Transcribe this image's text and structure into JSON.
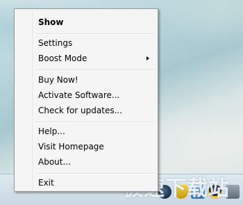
{
  "menu": {
    "items": [
      {
        "label": "Show",
        "bold": true
      },
      {
        "label": "Settings"
      },
      {
        "label": "Boost Mode",
        "submenu": true
      },
      {
        "label": "Buy Now!"
      },
      {
        "label": "Activate Software..."
      },
      {
        "label": "Check for updates..."
      },
      {
        "label": "Help..."
      },
      {
        "label": "Visit Homepage"
      },
      {
        "label": "About..."
      },
      {
        "label": "Exit"
      }
    ]
  },
  "watermark": {
    "text": "极速下载站"
  },
  "tray": {
    "icons": [
      "app-tray-icon",
      "shield-tray-icon",
      "network-tray-icon",
      "penguin-tray-icon",
      "misc-tray-icon"
    ]
  }
}
